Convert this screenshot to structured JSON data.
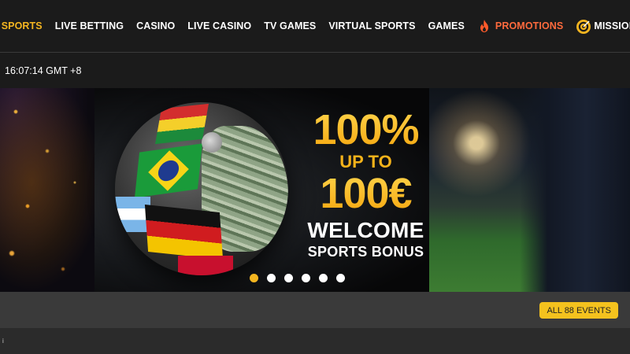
{
  "nav": {
    "items": [
      {
        "label": "SPORTS"
      },
      {
        "label": "LIVE BETTING"
      },
      {
        "label": "CASINO"
      },
      {
        "label": "LIVE CASINO"
      },
      {
        "label": "TV GAMES"
      },
      {
        "label": "VIRTUAL SPORTS"
      },
      {
        "label": "GAMES"
      },
      {
        "label": "PROMOTIONS",
        "icon": "flame-icon"
      },
      {
        "label": "MISSIONS",
        "icon": "target-icon"
      }
    ],
    "active_color": "#f4b520",
    "promo_color": "#ff6a3d"
  },
  "clock": {
    "text": "16:07:14 GMT +8"
  },
  "banner": {
    "headline": "100%",
    "subhead": "UP TO",
    "amount": "100€",
    "line1": "WELCOME",
    "line2": "SPORTS BONUS",
    "slides": 6,
    "active_slide": 1
  },
  "events": {
    "button_label": "ALL 88 EVENTS"
  },
  "footer": {
    "mark": "i"
  }
}
